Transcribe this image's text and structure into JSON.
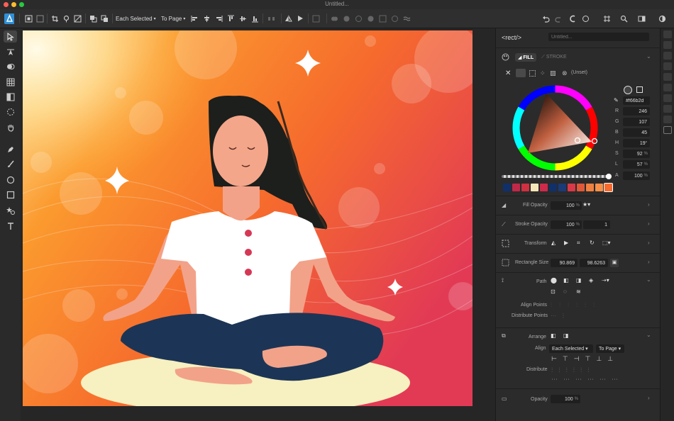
{
  "window": {
    "title": "Untitled..."
  },
  "toolbar": {
    "each_selected": "Each Selected",
    "to_page": "To Page"
  },
  "panel": {
    "element_tag": "<rect/>",
    "element_name_placeholder": "Untitled...",
    "fill_tab": "FILL",
    "stroke_tab": "STROKE",
    "unset": "(Unset)",
    "hex": "#f66b2d",
    "r_label": "R",
    "r": "246",
    "g_label": "G",
    "g": "107",
    "b_label": "B",
    "b": "45",
    "h_label": "H",
    "h": "19",
    "s_label": "S",
    "s": "92",
    "l_label": "L",
    "l": "57",
    "a_label": "A",
    "a": "100",
    "pct": "%",
    "deg": "°",
    "swatches": [
      "#10306a",
      "#c02848",
      "#d03040",
      "#f5e6b8",
      "#d02a4a",
      "#10306a",
      "#1a3a78",
      "#d83848",
      "#e05838",
      "#f08040",
      "#f89048",
      "#f66b2d"
    ],
    "fill_opacity_label": "Fill Opacity",
    "fill_opacity": "100",
    "stroke_opacity_label": "Stroke Opacity",
    "stroke_opacity": "100",
    "stroke_width": "1",
    "transform_label": "Transform",
    "rect_size_label": "Rectangle Size",
    "rect_w": "90.869",
    "rect_h": "98.6263",
    "path_label": "Path",
    "align_points_label": "Align Points",
    "distribute_points_label": "Distribute Points",
    "arrange_label": "Arrange",
    "align_label": "Align",
    "align_sel": "Each Selected",
    "align_to": "To Page",
    "distribute_label": "Distribute",
    "opacity_label": "Opacity",
    "opacity": "100"
  },
  "accent": "#2f8fd8",
  "selected_color": "#f66b2d"
}
